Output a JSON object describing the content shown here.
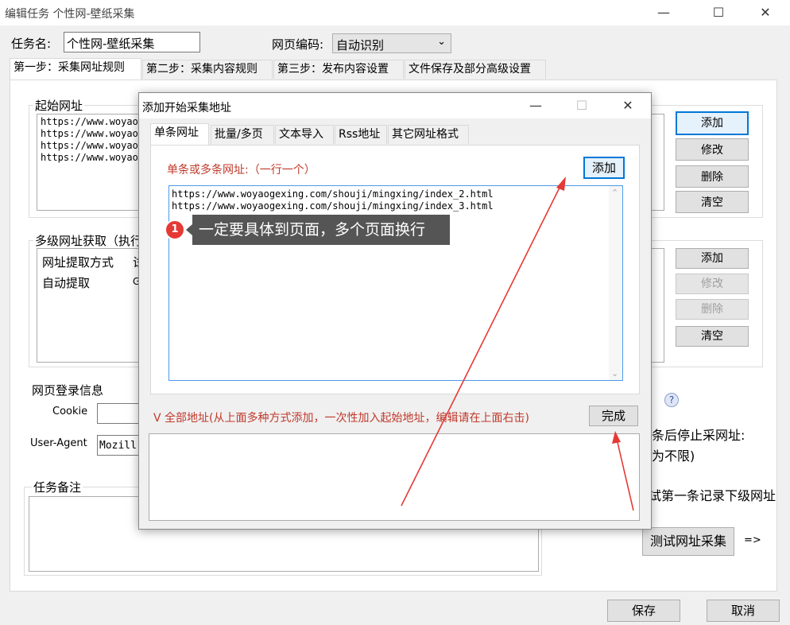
{
  "window": {
    "title": "编辑任务 个性网-壁纸采集",
    "minimize": "—",
    "maximize": "☐",
    "close": "✕"
  },
  "task": {
    "name_label": "任务名:",
    "name_value": "个性网-壁纸采集",
    "encoding_label": "网页编码:",
    "encoding_value": "自动识别"
  },
  "main_tabs": [
    "第一步：采集网址规则",
    "第二步：采集内容规则",
    "第三步：发布内容设置",
    "文件保存及部分高级设置"
  ],
  "start_urls": {
    "label": "起始网址",
    "lines": [
      "https://www.woyao",
      "https://www.woyao",
      "https://www.woyao",
      "https://www.woyao"
    ]
  },
  "right_buttons_top": [
    "添加",
    "修改",
    "删除",
    "清空"
  ],
  "multi_level": {
    "label": "多级网址获取（执行",
    "col1": "网址提取方式",
    "col2": "试",
    "row1_col1": "自动提取",
    "row1_col2": "G"
  },
  "right_buttons_mid": [
    "添加",
    "修改",
    "删除",
    "清空"
  ],
  "login": {
    "label": "网页登录信息",
    "cookie_label": "Cookie",
    "ua_label": "User-Agent",
    "ua_value": "Mozill"
  },
  "remark_label": "任务备注",
  "right_side_texts": {
    "stop_text": "条后停止采网址:",
    "unlimited": "为不限)",
    "test_first": "试第一条记录下级网址",
    "test_button": "测试网址采集",
    "arrow": "=>"
  },
  "bottom_buttons": {
    "save": "保存",
    "cancel": "取消"
  },
  "dialog": {
    "title": "添加开始采集地址",
    "minimize": "—",
    "maximize": "☐",
    "close": "✕",
    "tabs": [
      "单条网址",
      "批量/多页",
      "文本导入",
      "Rss地址",
      "其它网址格式"
    ],
    "single_label": "单条或多条网址:（一行一个）",
    "add_button": "添加",
    "urls": [
      "https://www.woyaogexing.com/shouji/mingxing/index_2.html",
      "https://www.woyaogexing.com/shouji/mingxing/index_3.html"
    ],
    "all_label": "V 全部地址(从上面多种方式添加，一次性加入起始地址，编辑请在上面右击)",
    "done_button": "完成"
  },
  "tooltip": {
    "badge": "1",
    "text": "一定要具体到页面，多个页面换行"
  },
  "colors": {
    "accent_red": "#e53935",
    "dialog_label": "#c0392b",
    "tooltip_bg": "#555555",
    "focus_blue": "#0078d7"
  }
}
